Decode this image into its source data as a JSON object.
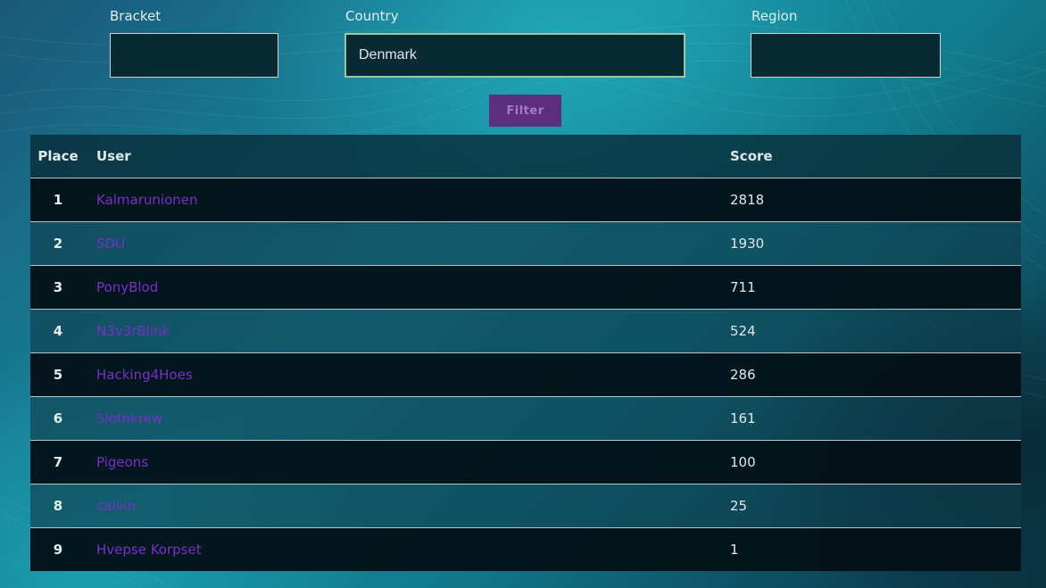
{
  "filters": {
    "bracket": {
      "label": "Bracket",
      "value": ""
    },
    "country": {
      "label": "Country",
      "value": "Denmark"
    },
    "region": {
      "label": "Region",
      "value": ""
    },
    "submit_label": "Filter"
  },
  "table": {
    "headers": {
      "place": "Place",
      "user": "User",
      "score": "Score"
    },
    "rows": [
      {
        "place": "1",
        "user": "Kalmarunionen",
        "score": "2818"
      },
      {
        "place": "2",
        "user": "SDU",
        "score": "1930"
      },
      {
        "place": "3",
        "user": "PonyBlod",
        "score": "711"
      },
      {
        "place": "4",
        "user": "N3v3rBlink",
        "score": "524"
      },
      {
        "place": "5",
        "user": "Hacking4Hoes",
        "score": "286"
      },
      {
        "place": "6",
        "user": "Slothkrew",
        "score": "161"
      },
      {
        "place": "7",
        "user": "Pigeons",
        "score": "100"
      },
      {
        "place": "8",
        "user": "calvin",
        "score": "25"
      },
      {
        "place": "9",
        "user": "Hvepse Korpset",
        "score": "1"
      }
    ]
  },
  "colors": {
    "accent_button": "#5d2d80",
    "user_link": "#7a2fc8",
    "focus_border": "#9ac7a4"
  }
}
